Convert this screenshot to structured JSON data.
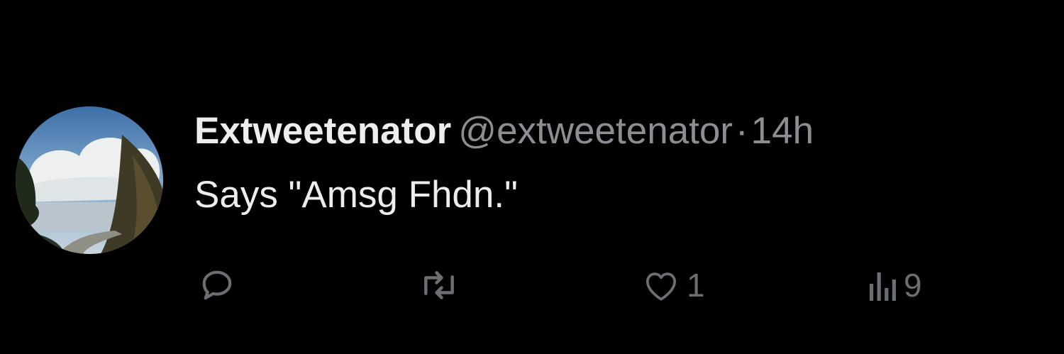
{
  "tweet": {
    "display_name": "Extweetenator",
    "handle": "@extweetenator",
    "separator": "·",
    "time": "14h",
    "text": "Says \"Amsg Fhdn.\"",
    "actions": {
      "reply_icon": "reply-icon",
      "retweet_icon": "retweet-icon",
      "like_icon": "heart-icon",
      "like_count": "1",
      "views_icon": "views-chart-icon",
      "views_count": "9"
    },
    "colors": {
      "background": "#000000",
      "primary_text": "#ededed",
      "secondary_text": "#8b8e92",
      "action_icons": "#6b6e72"
    }
  }
}
